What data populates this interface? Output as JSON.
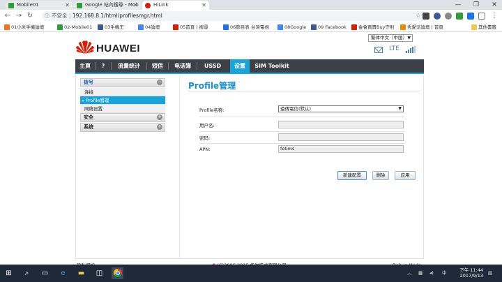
{
  "browser": {
    "tabs": [
      {
        "title": "Mobile01",
        "active": false
      },
      {
        "title": "Google 站內搜尋 - Mob",
        "active": false
      },
      {
        "title": "HiLink",
        "active": true
      }
    ],
    "security_label": "不安全",
    "url": "192.168.8.1/html/profilesmgr.html",
    "window_controls": {
      "minimize": "—",
      "maximize": "❐",
      "close": "✕"
    },
    "bookmarks": [
      {
        "label": "01小米手機論壇",
        "color": "#f36f21"
      },
      {
        "label": "02-Mobile01",
        "color": "#2e9d3a"
      },
      {
        "label": "03手機王",
        "color": "#3b5998"
      },
      {
        "label": "04論壇",
        "color": "#4285f4"
      },
      {
        "label": "05首頁 | 搜尋",
        "color": "#d81e06"
      },
      {
        "label": "06節目表 台灣電視",
        "color": "#1a73e8"
      },
      {
        "label": "08Google",
        "color": "#4285f4"
      },
      {
        "label": "09 Facebook",
        "color": "#3b5998"
      },
      {
        "label": "金會買賣Buy守則",
        "color": "#d81e06"
      },
      {
        "label": "秀愛派論壇 | 首頁",
        "color": "#e58c00"
      }
    ],
    "other_bookmarks": "其他書籤"
  },
  "header": {
    "language": "繁体中文（中国）",
    "brand": "HUAWEI",
    "network_type": "LTE",
    "signal_level": 0.8
  },
  "nav": {
    "items": [
      {
        "label": "主頁",
        "active": false
      },
      {
        "label": "?",
        "active": false
      },
      {
        "label": "流量统计",
        "active": false
      },
      {
        "label": "短信",
        "active": false
      },
      {
        "label": "电话簿",
        "active": false
      },
      {
        "label": "USSD",
        "active": false
      },
      {
        "label": "设置",
        "active": true
      },
      {
        "label": "SIM Toolkit",
        "active": false
      }
    ]
  },
  "sidebar": {
    "groups": [
      {
        "label": "拨号",
        "open": true,
        "toggle": "−",
        "items": [
          {
            "label": "连接",
            "active": false
          },
          {
            "label": "» Profile管理",
            "active": true
          },
          {
            "label": "网络设置",
            "active": false
          }
        ]
      },
      {
        "label": "安全",
        "open": false,
        "toggle": "+",
        "items": []
      },
      {
        "label": "系统",
        "open": false,
        "toggle": "+",
        "items": []
      }
    ]
  },
  "main": {
    "title": "Profile管理",
    "fields": {
      "profile_name_label": "Profile名称:",
      "profile_name_value": "遠傳電信(默认)",
      "username_label": "用户名:",
      "username_value": "",
      "password_label": "密码:",
      "password_value": "",
      "apn_label": "APN:",
      "apn_value": "fetims"
    },
    "buttons": {
      "new": "新建配置",
      "delete": "删除",
      "apply": "应用"
    }
  },
  "footer": {
    "privacy": "隐私保护",
    "copyright": "(C)2006-2015 华为技术有限公司。",
    "debug": "Debug Mode"
  },
  "taskbar": {
    "clock_time": "下午 11:44",
    "clock_date": "2017/9/13"
  }
}
